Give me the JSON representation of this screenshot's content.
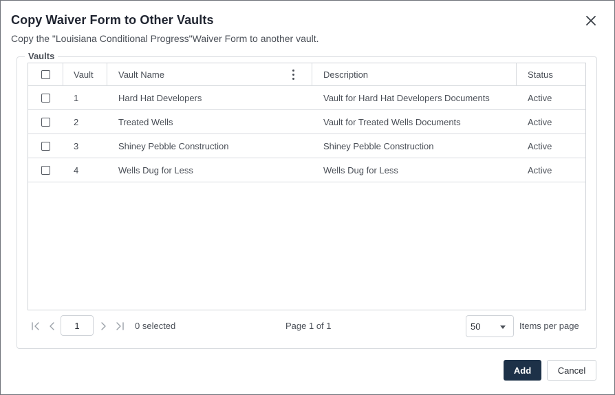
{
  "dialog": {
    "title": "Copy Waiver Form to Other Vaults",
    "subtitle": "Copy the \"Louisiana Conditional Progress\"Waiver Form to another vault.",
    "close_icon": "close-icon"
  },
  "vaults": {
    "legend": "Vaults",
    "columns": {
      "vault": "Vault",
      "name": "Vault Name",
      "description": "Description",
      "status": "Status"
    },
    "column_menu_icon": "kebab-menu-icon",
    "rows": [
      {
        "vault": "1",
        "name": "Hard Hat Developers",
        "description": "Vault for Hard Hat Developers Documents",
        "status": "Active"
      },
      {
        "vault": "2",
        "name": "Treated Wells",
        "description": "Vault for Treated Wells Documents",
        "status": "Active"
      },
      {
        "vault": "3",
        "name": "Shiney Pebble Construction",
        "description": "Shiney Pebble Construction",
        "status": "Active"
      },
      {
        "vault": "4",
        "name": "Wells Dug for Less",
        "description": "Wells Dug for Less",
        "status": "Active"
      }
    ]
  },
  "pager": {
    "page_value": "1",
    "selected": "0 selected",
    "page_info": "Page 1 of 1",
    "per_page_value": "50",
    "items_label": "Items per page"
  },
  "footer": {
    "add_label": "Add",
    "cancel_label": "Cancel"
  },
  "colors": {
    "primary_button": "#1d3148",
    "border": "#cfd3d8"
  }
}
